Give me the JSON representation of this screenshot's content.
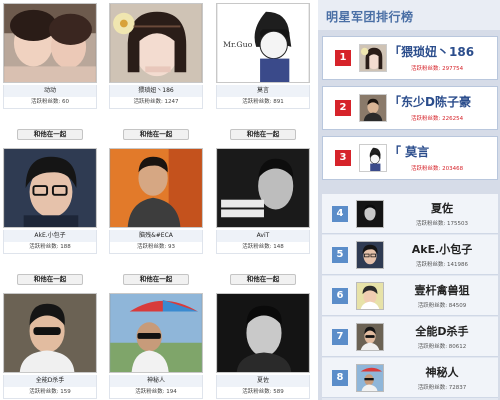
{
  "grid": {
    "cards": [
      {
        "name": "动动",
        "fans_label": "活跃粉丝数:",
        "fans": "60",
        "join_label": "和他在一起",
        "photo": "girl-selfie-photo",
        "join_visible": true
      },
      {
        "name": "猥琐妞丶186",
        "fans_label": "活跃粉丝数:",
        "fans": "1247",
        "join_label": "和他在一起",
        "photo": "girl-flower-photo",
        "join_visible": true
      },
      {
        "name": "莫言",
        "fans_label": "活跃粉丝数:",
        "fans": "891",
        "join_label": "和他在一起",
        "photo": "cartoon-mrguo-photo",
        "join_visible": true
      },
      {
        "name": "AkE.小包子",
        "fans_label": "活跃粉丝数:",
        "fans": "188",
        "join_label": "和他在一起",
        "photo": "boy-glasses-photo",
        "join_visible": true
      },
      {
        "name": "脑残&#ECA",
        "fans_label": "活跃粉丝数:",
        "fans": "93",
        "join_label": "和他在一起",
        "photo": "man-orange-bg-photo",
        "join_visible": true
      },
      {
        "name": "AviT",
        "fans_label": "活跃粉丝数:",
        "fans": "148",
        "join_label": "和他在一起",
        "photo": "man-bw-poster-photo",
        "join_visible": true
      },
      {
        "name": "全能D杀手",
        "fans_label": "活跃粉丝数:",
        "fans": "159",
        "join_label": "",
        "photo": "boy-sunglasses-photo",
        "join_visible": false
      },
      {
        "name": "神秘人",
        "fans_label": "活跃粉丝数:",
        "fans": "194",
        "join_label": "",
        "photo": "man-umbrella-photo",
        "join_visible": false
      },
      {
        "name": "夏佐",
        "fans_label": "活跃粉丝数:",
        "fans": "589",
        "join_label": "",
        "photo": "man-bw-portrait-photo",
        "join_visible": false
      }
    ]
  },
  "rank": {
    "title": "明星军团排行榜",
    "top": [
      {
        "rank": "1",
        "name": "「猥琐妞丶186",
        "fans_label": "活跃粉丝数:",
        "fans": "297754"
      },
      {
        "rank": "2",
        "name": "「东少D陈子豪",
        "fans_label": "活跃粉丝数:",
        "fans": "226254"
      },
      {
        "rank": "3",
        "name": "「   莫言",
        "fans_label": "活跃粉丝数:",
        "fans": "203468"
      }
    ],
    "rest": [
      {
        "rank": "4",
        "name": "夏佐",
        "fans_label": "活跃粉丝数:",
        "fans": "175503"
      },
      {
        "rank": "5",
        "name": "AkE.小包子",
        "fans_label": "活跃粉丝数:",
        "fans": "141986"
      },
      {
        "rank": "6",
        "name": "壹杆禽兽狙",
        "fans_label": "活跃粉丝数:",
        "fans": "84509"
      },
      {
        "rank": "7",
        "name": "全能D杀手",
        "fans_label": "活跃粉丝数:",
        "fans": "80612"
      },
      {
        "rank": "8",
        "name": "神秘人",
        "fans_label": "活跃粉丝数:",
        "fans": "72837"
      }
    ]
  },
  "colors": {
    "accent": "#d6232a",
    "title_blue": "#4a6fa5",
    "panel_bg": "#d6dce8",
    "rank_badge_blue": "#5b8dc9"
  }
}
